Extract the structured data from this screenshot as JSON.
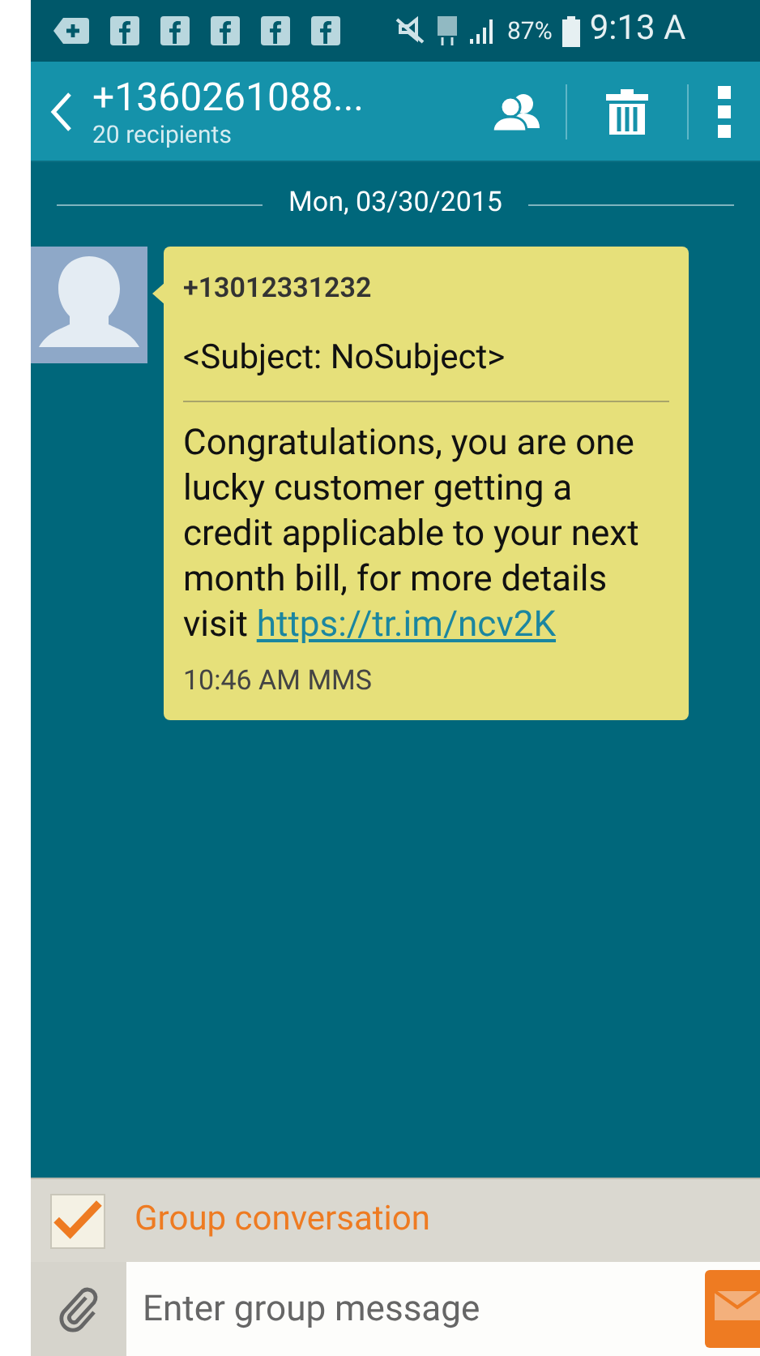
{
  "status_bar": {
    "battery": "87%",
    "time": "9:13 A"
  },
  "header": {
    "title": "+1360261088...",
    "subtitle": "20 recipients"
  },
  "date_divider": "Mon, 03/30/2015",
  "messages": [
    {
      "sender": "+13012331232",
      "subject": "<Subject: NoSubject>",
      "body": "Congratulations, you are one lucky customer getting a credit applicable to your next month bill, for more details visit ",
      "link": "https://tr.im/ncv2K",
      "meta": "10:46 AM MMS"
    }
  ],
  "group_conversation": {
    "label": "Group conversation",
    "checked": true
  },
  "composer": {
    "placeholder": "Enter group message"
  }
}
